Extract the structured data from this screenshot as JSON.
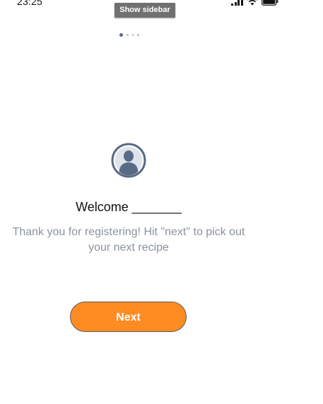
{
  "status_bar": {
    "time": "23:25",
    "icons": [
      "cellular-signal-icon",
      "wifi-icon",
      "battery-icon"
    ]
  },
  "sidebar_toggle": {
    "label": "Show sidebar"
  },
  "pager": {
    "total": 4,
    "active_index": 0
  },
  "avatar": {
    "icon": "user-avatar-icon"
  },
  "welcome": {
    "title": "Welcome _______",
    "subtitle": "Thank you for registering! Hit \"next\" to pick out your next recipe"
  },
  "actions": {
    "next_label": "Next"
  },
  "colors": {
    "accent": "#ff8c22",
    "avatar": "#5a6a84",
    "subtitle_text": "#8a93a1",
    "tooltip_bg": "#707070"
  }
}
